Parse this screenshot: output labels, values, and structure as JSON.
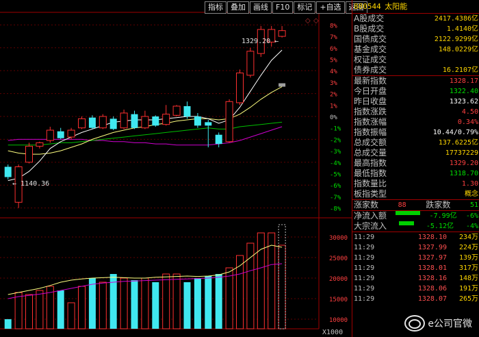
{
  "toolbar": [
    "指标",
    "叠加",
    "画线",
    "F10",
    "标记",
    "+自选",
    "返回"
  ],
  "header": {
    "code": "880544",
    "name": "太阳能"
  },
  "chart_labels": {
    "high": "1329.20",
    "low": "1140.36",
    "vol_unit": "X1000"
  },
  "price_axis": [
    "8%",
    "7%",
    "6%",
    "5%",
    "4%",
    "3%",
    "2%",
    "1%",
    "0%",
    "-1%",
    "-2%",
    "-3%",
    "-4%",
    "-5%",
    "-6%",
    "-7%",
    "-8%"
  ],
  "volume_axis": [
    "30000",
    "25000",
    "20000",
    "15000",
    "10000"
  ],
  "stats": [
    {
      "label": "A股成交",
      "value": "2417.4386亿",
      "color": "yellow"
    },
    {
      "label": "B股成交",
      "value": "1.4140亿",
      "color": "yellow"
    },
    {
      "label": "国债成交",
      "value": "2122.9299亿",
      "color": "yellow"
    },
    {
      "label": "基金成交",
      "value": "148.0229亿",
      "color": "yellow"
    },
    {
      "label": "权证成交",
      "value": "",
      "color": "yellow"
    },
    {
      "label": "债券成交",
      "value": "16.2107亿",
      "color": "yellow"
    },
    {
      "label": "最新指数",
      "value": "1328.17",
      "color": "red"
    },
    {
      "label": "今日开盘",
      "value": "1322.40",
      "color": "green"
    },
    {
      "label": "昨日收盘",
      "value": "1323.62",
      "color": "white"
    },
    {
      "label": "指数涨跌",
      "value": "4.50",
      "color": "red"
    },
    {
      "label": "指数涨幅",
      "value": "0.34%",
      "color": "red"
    },
    {
      "label": "指数振幅",
      "value": "10.44/0.79%",
      "color": "white"
    },
    {
      "label": "总成交额",
      "value": "137.6225亿",
      "color": "yellow"
    },
    {
      "label": "总成交量",
      "value": "17737229",
      "color": "yellow"
    },
    {
      "label": "最高指数",
      "value": "1329.20",
      "color": "red"
    },
    {
      "label": "最低指数",
      "value": "1318.70",
      "color": "green"
    },
    {
      "label": "指数量比",
      "value": "1.30",
      "color": "red"
    },
    {
      "label": "板指类型",
      "value": "概念",
      "color": "yellow"
    }
  ],
  "breadth": {
    "up_label": "涨家数",
    "up": "88",
    "down_label": "跌家数",
    "down": "51"
  },
  "flows": [
    {
      "label": "净流入额",
      "value": "-7.99亿",
      "pct": "-6%",
      "bar": 0.45
    },
    {
      "label": "大宗流入",
      "value": "-5.12亿",
      "pct": "-4%",
      "bar": 0.28
    }
  ],
  "ticks": [
    {
      "time": "11:29",
      "price": "1328.10",
      "vol": "234万"
    },
    {
      "time": "11:29",
      "price": "1327.99",
      "vol": "224万"
    },
    {
      "time": "11:29",
      "price": "1327.97",
      "vol": "139万"
    },
    {
      "time": "11:29",
      "price": "1328.01",
      "vol": "317万"
    },
    {
      "time": "11:29",
      "price": "1328.16",
      "vol": "148万"
    },
    {
      "time": "11:29",
      "price": "1328.06",
      "vol": "191万"
    },
    {
      "time": "11:29",
      "price": "1328.07",
      "vol": "265万"
    }
  ],
  "watermark": "e公司官微",
  "chart_data": {
    "type": "candlestick",
    "candles": [
      {
        "o": -4.4,
        "c": -5.3,
        "h": -4.2,
        "l": -5.5
      },
      {
        "o": -7.5,
        "c": -4.4,
        "h": -4.2,
        "l": -8.0
      },
      {
        "o": -4.0,
        "c": -2.6,
        "h": -2.3,
        "l": -4.1
      },
      {
        "o": -2.6,
        "c": -2.3,
        "h": -2.2,
        "l": -2.8
      },
      {
        "o": -2.1,
        "c": -1.2,
        "h": -0.9,
        "l": -2.3
      },
      {
        "o": -1.3,
        "c": -1.9,
        "h": -1.0,
        "l": -2.0
      },
      {
        "o": -1.8,
        "c": -1.2,
        "h": -1.0,
        "l": -2.0
      },
      {
        "o": -1.0,
        "c": -0.2,
        "h": 0.0,
        "l": -1.1
      },
      {
        "o": -0.1,
        "c": -1.0,
        "h": 0.1,
        "l": -1.1
      },
      {
        "o": -1.0,
        "c": 0.0,
        "h": 0.2,
        "l": -1.1
      },
      {
        "o": -0.2,
        "c": -1.1,
        "h": 0.0,
        "l": -1.2
      },
      {
        "o": -1.0,
        "c": 0.3,
        "h": 0.6,
        "l": -1.1
      },
      {
        "o": 0.2,
        "c": -1.0,
        "h": 0.5,
        "l": -1.1
      },
      {
        "o": -1.0,
        "c": 0.0,
        "h": 0.5,
        "l": -1.1
      },
      {
        "o": 0.0,
        "c": -0.8,
        "h": 0.1,
        "l": -0.9
      },
      {
        "o": -0.7,
        "c": 0.2,
        "h": 1.0,
        "l": -0.8
      },
      {
        "o": 0.1,
        "c": 0.9,
        "h": 1.0,
        "l": 0.0
      },
      {
        "o": 0.9,
        "c": 0.0,
        "h": 1.3,
        "l": -0.2
      },
      {
        "o": 0.0,
        "c": -0.8,
        "h": 0.3,
        "l": -1.0
      },
      {
        "o": -0.5,
        "c": -0.8,
        "h": -0.3,
        "l": -2.7
      },
      {
        "o": -1.6,
        "c": -2.4,
        "h": -1.4,
        "l": -2.7
      },
      {
        "o": -2.2,
        "c": 1.3,
        "h": 1.5,
        "l": -2.3
      },
      {
        "o": 1.2,
        "c": 3.8,
        "h": 4.1,
        "l": 1.0
      },
      {
        "o": 3.6,
        "c": 5.7,
        "h": 6.0,
        "l": 3.4
      },
      {
        "o": 5.5,
        "c": 7.6,
        "h": 7.9,
        "l": 5.2
      },
      {
        "o": 6.5,
        "c": 7.6,
        "h": 7.9,
        "l": 6.1
      },
      {
        "o": 7.0,
        "c": 7.5,
        "h": 7.9,
        "l": 6.9
      }
    ],
    "ma5": [
      -5.6,
      -5.4,
      -4.8,
      -3.9,
      -2.8,
      -2.2,
      -1.8,
      -1.4,
      -1.1,
      -0.8,
      -0.5,
      -0.4,
      -0.3,
      -0.3,
      -0.3,
      -0.2,
      -0.1,
      0.0,
      0.0,
      -0.2,
      -0.6,
      -0.3,
      0.8,
      2.2,
      3.6,
      4.9,
      5.8
    ],
    "ma10": [
      -3.0,
      -3.2,
      -3.3,
      -3.3,
      -3.2,
      -3.0,
      -2.7,
      -2.4,
      -2.0,
      -1.7,
      -1.4,
      -1.2,
      -1.0,
      -0.9,
      -0.7,
      -0.6,
      -0.4,
      -0.3,
      -0.2,
      -0.2,
      -0.3,
      -0.2,
      0.2,
      0.8,
      1.5,
      2.1,
      2.6
    ],
    "ma20": [
      -2.5,
      -2.5,
      -2.5,
      -2.5,
      -2.4,
      -2.3,
      -2.3,
      -2.2,
      -2.1,
      -2.0,
      -1.9,
      -1.8,
      -1.7,
      -1.6,
      -1.5,
      -1.4,
      -1.3,
      -1.2,
      -1.1,
      -1.0,
      -1.1,
      -1.1,
      -0.9,
      -0.8,
      -0.7,
      -0.6,
      -0.5
    ],
    "ma60": [
      -2.1,
      -2.0,
      -2.0,
      -2.0,
      -2.0,
      -2.0,
      -2.0,
      -2.0,
      -2.1,
      -2.1,
      -2.2,
      -2.2,
      -2.3,
      -2.3,
      -2.4,
      -2.4,
      -2.5,
      -2.5,
      -2.5,
      -2.5,
      -2.4,
      -2.3,
      -2.1,
      -1.8,
      -1.5,
      -1.2,
      -0.9
    ],
    "volumes": [
      10000,
      16500,
      16000,
      17000,
      18000,
      17000,
      14000,
      18000,
      20000,
      19000,
      21000,
      20000,
      19500,
      20000,
      19000,
      21000,
      21000,
      19000,
      20000,
      20500,
      21000,
      22500,
      25500,
      28500,
      31000,
      31000,
      28000
    ],
    "vol_ma5": [
      16000,
      16500,
      17000,
      17500,
      18200,
      19000,
      19500,
      19800,
      20000,
      20100,
      20200,
      20100,
      20000,
      20000,
      20200,
      20300,
      20400,
      20500,
      20400,
      20500,
      20800,
      21500,
      23000,
      25000,
      27000,
      28000,
      27500
    ],
    "vol_ma10": [
      15000,
      15500,
      15800,
      16100,
      16500,
      17000,
      17500,
      18000,
      18500,
      18800,
      19000,
      19200,
      19300,
      19400,
      19500,
      19600,
      19700,
      19800,
      19900,
      20000,
      20200,
      20500,
      21000,
      21800,
      22500,
      23300,
      23500
    ],
    "price_range": [
      -8.5,
      8.5
    ],
    "volume_range": [
      8000,
      34000
    ]
  }
}
